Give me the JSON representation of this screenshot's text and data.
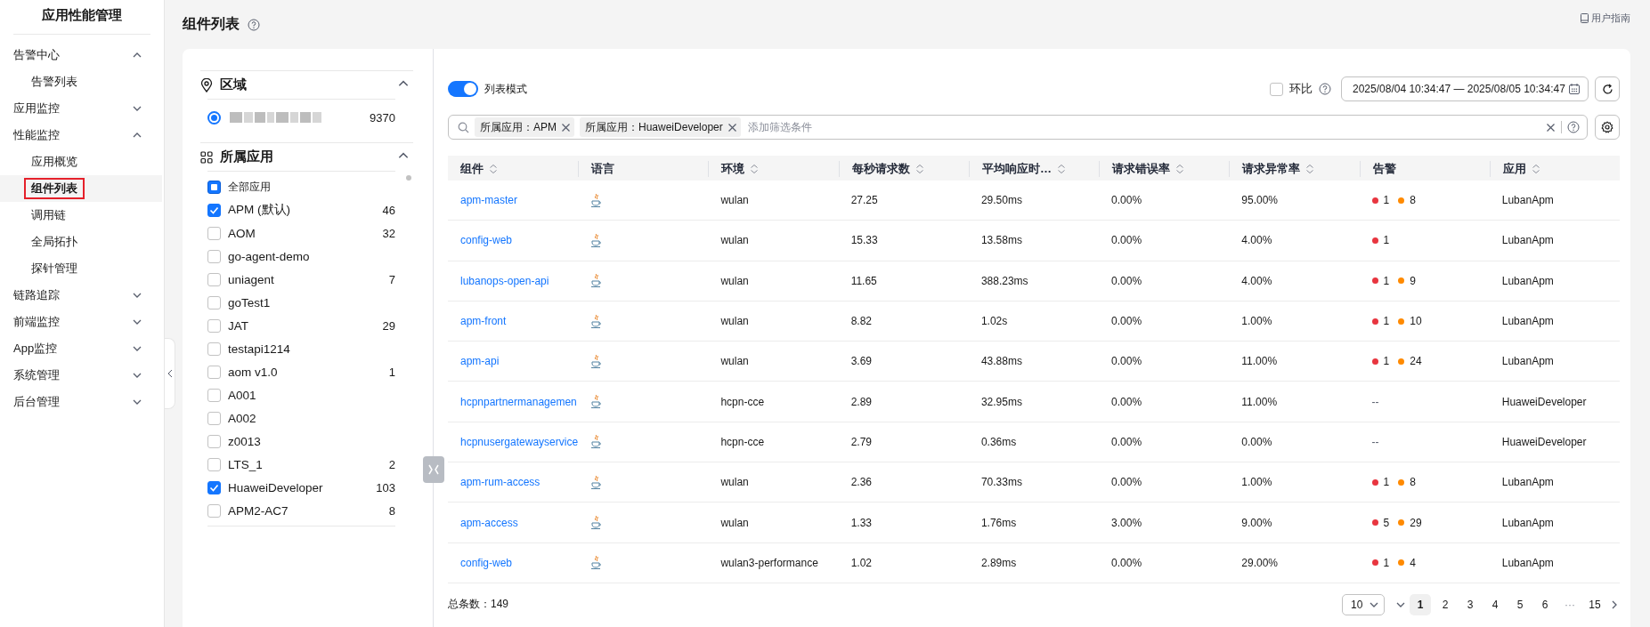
{
  "sidebar": {
    "title": "应用性能管理",
    "items": [
      {
        "label": "告警中心",
        "expanded": true,
        "children": [
          {
            "label": "告警列表",
            "selected": false
          }
        ]
      },
      {
        "label": "应用监控",
        "expanded": false
      },
      {
        "label": "性能监控",
        "expanded": true,
        "children": [
          {
            "label": "应用概览",
            "selected": false
          },
          {
            "label": "组件列表",
            "selected": true
          },
          {
            "label": "调用链",
            "selected": false
          },
          {
            "label": "全局拓扑",
            "selected": false
          },
          {
            "label": "探针管理",
            "selected": false
          }
        ]
      },
      {
        "label": "链路追踪",
        "expanded": false
      },
      {
        "label": "前端监控",
        "expanded": false
      },
      {
        "label": "App监控",
        "expanded": false
      },
      {
        "label": "系统管理",
        "expanded": false
      },
      {
        "label": "后台管理",
        "expanded": false
      }
    ]
  },
  "header": {
    "title": "组件列表",
    "guide_link": "用户指南"
  },
  "filters": {
    "region": {
      "title": "区域",
      "expanded": true,
      "options": [
        {
          "count": "9370",
          "selected": true
        }
      ]
    },
    "apps": {
      "title": "所属应用",
      "expanded": true,
      "items": [
        {
          "label": "全部应用",
          "checked": false,
          "indeterminate": true
        },
        {
          "label": "APM (默认)",
          "count": "46",
          "checked": true,
          "indeterminate": false
        },
        {
          "label": "AOM",
          "count": "32",
          "checked": false,
          "indeterminate": false
        },
        {
          "label": "go-agent-demo",
          "checked": false,
          "indeterminate": false
        },
        {
          "label": "uniagent",
          "count": "7",
          "checked": false,
          "indeterminate": false
        },
        {
          "label": "goTest1",
          "checked": false,
          "indeterminate": false
        },
        {
          "label": "JAT",
          "count": "29",
          "checked": false,
          "indeterminate": false
        },
        {
          "label": "testapi1214",
          "checked": false,
          "indeterminate": false
        },
        {
          "label": "aom v1.0",
          "count": "1",
          "checked": false,
          "indeterminate": false
        },
        {
          "label": "A001",
          "checked": false,
          "indeterminate": false
        },
        {
          "label": "A002",
          "checked": false,
          "indeterminate": false
        },
        {
          "label": "z0013",
          "checked": false,
          "indeterminate": false
        },
        {
          "label": "LTS_1",
          "count": "2",
          "checked": false,
          "indeterminate": false
        },
        {
          "label": "HuaweiDeveloper",
          "count": "103",
          "checked": true,
          "indeterminate": false
        },
        {
          "label": "APM2-AC7",
          "count": "8",
          "checked": false,
          "indeterminate": false
        }
      ]
    }
  },
  "toolbar": {
    "list_mode": {
      "label": "列表模式",
      "on": true
    },
    "compare": {
      "label": "环比",
      "checked": false
    },
    "date_range": "2025/08/04 10:34:47 — 2025/08/05 10:34:47"
  },
  "filter_bar": {
    "tags": [
      "所属应用：APM",
      "所属应用：HuaweiDeveloper"
    ],
    "placeholder": "添加筛选条件"
  },
  "table": {
    "columns": [
      {
        "label": "组件",
        "sortable": true
      },
      {
        "label": "语言",
        "sortable": false
      },
      {
        "label": "环境",
        "sortable": true
      },
      {
        "label": "每秒请求数",
        "sortable": true
      },
      {
        "label": "平均响应时…",
        "sortable": true
      },
      {
        "label": "请求错误率",
        "sortable": true
      },
      {
        "label": "请求异常率",
        "sortable": true
      },
      {
        "label": "告警",
        "sortable": false
      },
      {
        "label": "应用",
        "sortable": true
      }
    ],
    "rows": [
      {
        "component": "apm-master",
        "env": "wulan",
        "qps": "27.25",
        "avg": "29.50ms",
        "error_rate": "0.00%",
        "exception_rate": "95.00%",
        "alarms": [
          {
            "color": "#e8353f",
            "count": "1"
          },
          {
            "color": "#ff8a00",
            "count": "8"
          }
        ],
        "app": "LubanApm"
      },
      {
        "component": "config-web",
        "env": "wulan",
        "qps": "15.33",
        "avg": "13.58ms",
        "error_rate": "0.00%",
        "exception_rate": "4.00%",
        "alarms": [
          {
            "color": "#e8353f",
            "count": "1"
          }
        ],
        "app": "LubanApm"
      },
      {
        "component": "lubanops-open-api",
        "env": "wulan",
        "qps": "11.65",
        "avg": "388.23ms",
        "error_rate": "0.00%",
        "exception_rate": "4.00%",
        "alarms": [
          {
            "color": "#e8353f",
            "count": "1"
          },
          {
            "color": "#ff8a00",
            "count": "9"
          }
        ],
        "app": "LubanApm"
      },
      {
        "component": "apm-front",
        "env": "wulan",
        "qps": "8.82",
        "avg": "1.02s",
        "error_rate": "0.00%",
        "exception_rate": "1.00%",
        "alarms": [
          {
            "color": "#e8353f",
            "count": "1"
          },
          {
            "color": "#ff8a00",
            "count": "10"
          }
        ],
        "app": "LubanApm"
      },
      {
        "component": "apm-api",
        "env": "wulan",
        "qps": "3.69",
        "avg": "43.88ms",
        "error_rate": "0.00%",
        "exception_rate": "11.00%",
        "alarms": [
          {
            "color": "#e8353f",
            "count": "1"
          },
          {
            "color": "#ff8a00",
            "count": "24"
          }
        ],
        "app": "LubanApm"
      },
      {
        "component": "hcpnpartnermanagemen",
        "env": "hcpn-cce",
        "qps": "2.89",
        "avg": "32.95ms",
        "error_rate": "0.00%",
        "exception_rate": "11.00%",
        "alarm_text": "--",
        "app": "HuaweiDeveloper"
      },
      {
        "component": "hcpnusergatewayservice",
        "env": "hcpn-cce",
        "qps": "2.79",
        "avg": "0.36ms",
        "error_rate": "0.00%",
        "exception_rate": "0.00%",
        "alarm_text": "--",
        "app": "HuaweiDeveloper"
      },
      {
        "component": "apm-rum-access",
        "env": "wulan",
        "qps": "2.36",
        "avg": "70.33ms",
        "error_rate": "0.00%",
        "exception_rate": "1.00%",
        "alarms": [
          {
            "color": "#e8353f",
            "count": "1"
          },
          {
            "color": "#ff8a00",
            "count": "8"
          }
        ],
        "app": "LubanApm"
      },
      {
        "component": "apm-access",
        "env": "wulan",
        "qps": "1.33",
        "avg": "1.76ms",
        "error_rate": "3.00%",
        "exception_rate": "9.00%",
        "alarms": [
          {
            "color": "#e8353f",
            "count": "5"
          },
          {
            "color": "#ff8a00",
            "count": "29"
          }
        ],
        "app": "LubanApm"
      },
      {
        "component": "config-web",
        "env": "wulan3-performance",
        "qps": "1.02",
        "avg": "2.89ms",
        "error_rate": "0.00%",
        "exception_rate": "29.00%",
        "alarms": [
          {
            "color": "#e8353f",
            "count": "1"
          },
          {
            "color": "#ff8a00",
            "count": "4"
          }
        ],
        "app": "LubanApm"
      }
    ]
  },
  "footer": {
    "total": "总条数：149",
    "page_size": "10",
    "pages": [
      {
        "label": "1",
        "kind": "page",
        "selected": true
      },
      {
        "label": "2",
        "kind": "page",
        "selected": false
      },
      {
        "label": "3",
        "kind": "page",
        "selected": false
      },
      {
        "label": "4",
        "kind": "page",
        "selected": false
      },
      {
        "label": "5",
        "kind": "page",
        "selected": false
      },
      {
        "label": "6",
        "kind": "page",
        "selected": false
      },
      {
        "label": "···",
        "kind": "ellipsis",
        "selected": false
      },
      {
        "label": "15",
        "kind": "page",
        "selected": false
      }
    ]
  }
}
